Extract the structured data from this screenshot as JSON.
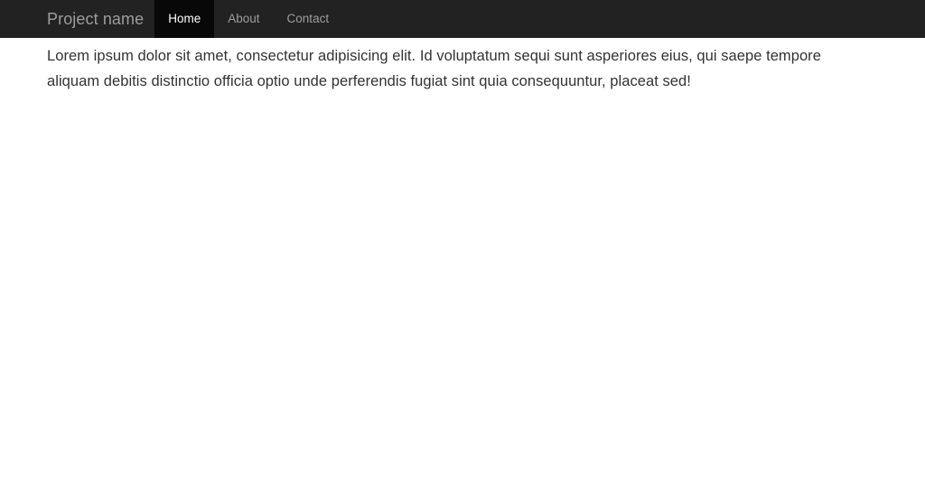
{
  "navbar": {
    "brand": "Project name",
    "background_color": "#222222",
    "link_color": "#9d9d9d",
    "active_background_color": "#080808",
    "active_link_color": "#ffffff",
    "items": [
      {
        "label": "Home",
        "active": true
      },
      {
        "label": "About",
        "active": false
      },
      {
        "label": "Contact",
        "active": false
      }
    ]
  },
  "main": {
    "paragraph": "Lorem ipsum dolor sit amet, consectetur adipisicing elit. Id voluptatum sequi sunt asperiores eius, qui saepe tempore aliquam debitis distinctio officia optio unde perferendis fugiat sint quia consequuntur, placeat sed!",
    "text_color": "#333333",
    "background_color": "#ffffff"
  }
}
